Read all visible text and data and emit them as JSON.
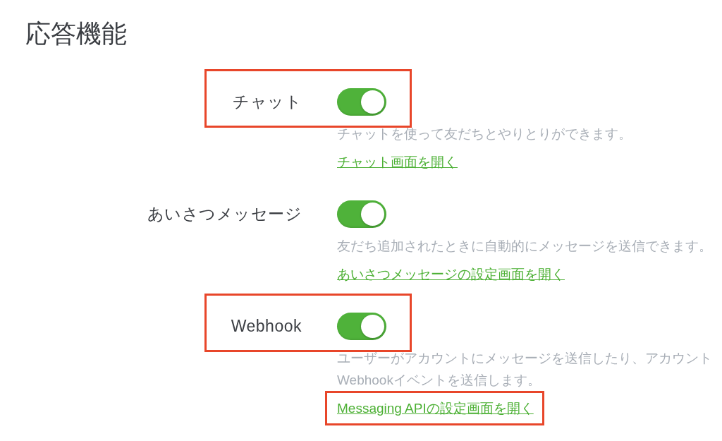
{
  "title": "応答機能",
  "features": [
    {
      "label": "チャット",
      "on": true,
      "highlighted": true,
      "description": [
        "チャットを使って友だちとやりとりができます。"
      ],
      "link": {
        "text": "チャット画面を開く",
        "highlighted": false
      }
    },
    {
      "label": "あいさつメッセージ",
      "on": true,
      "highlighted": false,
      "description": [
        "友だち追加されたときに自動的にメッセージを送信できます。"
      ],
      "link": {
        "text": "あいさつメッセージの設定画面を開く",
        "highlighted": false
      }
    },
    {
      "label": "Webhook",
      "on": true,
      "highlighted": true,
      "description": [
        "ユーザーがアカウントにメッセージを送信したり、アカウント",
        "Webhookイベントを送信します。"
      ],
      "link": {
        "text": "Messaging APIの設定画面を開く",
        "highlighted": true
      }
    }
  ]
}
